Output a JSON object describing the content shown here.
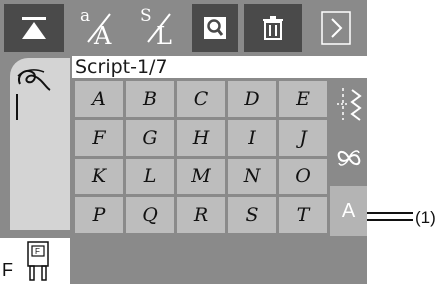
{
  "toolbar": {
    "buttons": [
      {
        "name": "move-top",
        "icon": "up-arrow-bar-icon"
      },
      {
        "name": "small-case",
        "icon": "letter-a-case-icon",
        "top": "a",
        "bottom": "A"
      },
      {
        "name": "size",
        "icon": "size-s-l-icon",
        "top": "S",
        "bottom": "L"
      },
      {
        "name": "zoom",
        "icon": "magnifier-icon"
      },
      {
        "name": "delete",
        "icon": "trash-icon"
      },
      {
        "name": "next",
        "icon": "chevron-right-icon"
      }
    ]
  },
  "header": {
    "title": "Script-1/7"
  },
  "grid": {
    "characters": [
      "A",
      "B",
      "C",
      "D",
      "E",
      "F",
      "G",
      "H",
      "I",
      "J",
      "K",
      "L",
      "M",
      "N",
      "O",
      "P",
      "Q",
      "R",
      "S",
      "T"
    ]
  },
  "right_column": {
    "items": [
      {
        "name": "stitch-pattern",
        "icon": "stitch-zigzag-icon"
      },
      {
        "name": "loop-pattern",
        "icon": "infinity-loop-icon"
      },
      {
        "name": "alphabet",
        "label": "A",
        "active": true
      }
    ]
  },
  "left_panel": {
    "bottom_label": "F"
  },
  "callout": {
    "label": "(1)"
  }
}
